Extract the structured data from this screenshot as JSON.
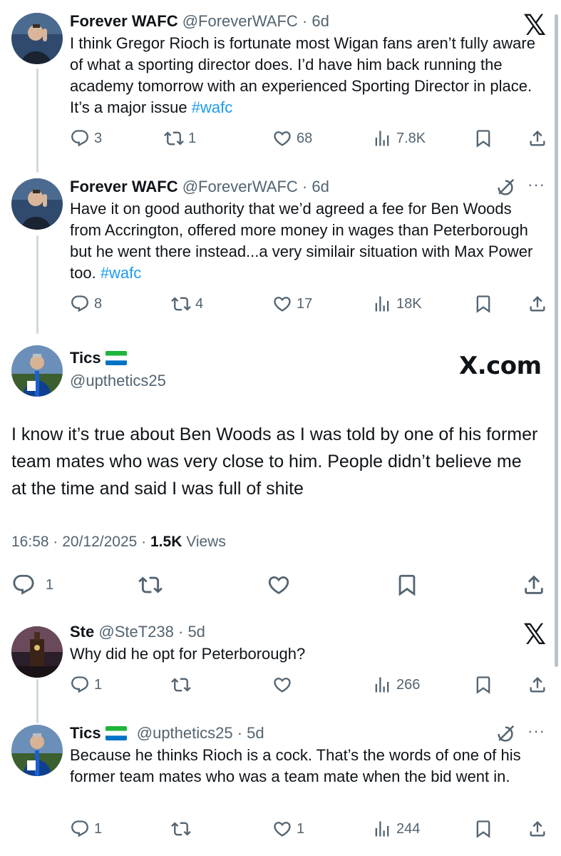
{
  "tweets": [
    {
      "name": "Forever WAFC",
      "handle": "@ForeverWAFC",
      "time": "· 6d",
      "text": "I think Gregor Rioch is fortunate most Wigan fans aren’t fully aware of what a sporting director does. I’d have him back running the academy tomorrow with an experienced Sporting Director in place. It’s a major issue ",
      "hashtag": "#wafc",
      "replies": "3",
      "reposts": "1",
      "likes": "68",
      "views": "7.8K",
      "corner_icon": "x-logo-icon"
    },
    {
      "name": "Forever WAFC",
      "handle": "@ForeverWAFC",
      "time": "· 6d",
      "text": "Have it on good authority that we’d agreed a fee for Ben Woods from Accrington, offered more money in wages than Peterborough but he went there instead...a very similair situation with Max Power too. ",
      "hashtag": "#wafc",
      "replies": "8",
      "reposts": "4",
      "likes": "17",
      "views": "18K",
      "corner_icon": "grok-icon"
    }
  ],
  "main_tweet": {
    "name": "Tics",
    "handle": "@upthetics25",
    "brand": "X.com",
    "text": "I know it’s true about Ben Woods as I was told by one of his former team mates who was very close to him. People didn’t believe me at the time and said I was full of shite",
    "time": "16:58 · 20/12/2025 ·",
    "views_count": "1.5K",
    "views_label": "Views",
    "replies": "1"
  },
  "replies": [
    {
      "name": "Ste",
      "handle": "@SteT238",
      "time": "· 5d",
      "text": "Why did he opt for Peterborough?",
      "replies": "1",
      "reposts": "",
      "likes": "",
      "views": "266",
      "corner_icon": "x-logo-icon"
    },
    {
      "name": "Tics",
      "handle": "@upthetics25",
      "time": "· 5d",
      "text": "Because he thinks Rioch is a cock. That’s the words of one of his former team mates who was a team mate when the bid went in.",
      "replies": "1",
      "reposts": "",
      "likes": "1",
      "views": "244",
      "corner_icon": "grok-icon"
    }
  ],
  "icons": {
    "reply": "reply-icon",
    "repost": "repost-icon",
    "like": "like-icon",
    "views": "views-icon",
    "bookmark": "bookmark-icon",
    "share": "share-icon",
    "flag": "sierra-leone-flag-icon"
  },
  "colors": {
    "text": "#0f1419",
    "secondary": "#536471",
    "link": "#1d9bf0",
    "thread_line": "#cfd9de"
  }
}
